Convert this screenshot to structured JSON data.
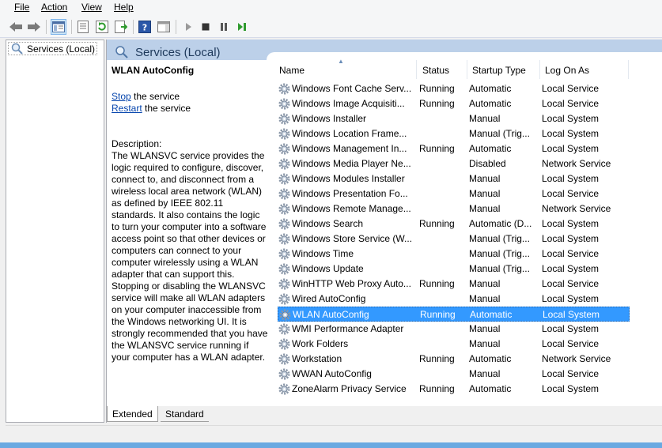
{
  "menu": [
    {
      "label": "File"
    },
    {
      "label": "Action"
    },
    {
      "label": "View"
    },
    {
      "label": "Help"
    }
  ],
  "tree": {
    "root_label": "Services (Local)"
  },
  "main": {
    "title": "Services (Local)",
    "selected_service": "WLAN AutoConfig",
    "stop_link": "Stop",
    "stop_suffix": " the service",
    "restart_link": "Restart",
    "restart_suffix": " the service",
    "description_label": "Description:",
    "description_text": "The WLANSVC service provides the logic required to configure, discover, connect to, and disconnect from a wireless local area network (WLAN) as defined by IEEE 802.11 standards. It also contains the logic to turn your computer into a software access point so that other devices or computers can connect to your computer wirelessly using a WLAN adapter that can support this. Stopping or disabling the WLANSVC service will make all WLAN adapters on your computer inaccessible from the Windows networking UI. It is strongly recommended that you have the WLANSVC service running if your computer has a WLAN adapter."
  },
  "columns": [
    "Name",
    "Status",
    "Startup Type",
    "Log On As"
  ],
  "services": [
    {
      "name": "Windows Font Cache Serv...",
      "status": "Running",
      "startup": "Automatic",
      "logon": "Local Service"
    },
    {
      "name": "Windows Image Acquisiti...",
      "status": "Running",
      "startup": "Automatic",
      "logon": "Local Service"
    },
    {
      "name": "Windows Installer",
      "status": "",
      "startup": "Manual",
      "logon": "Local System"
    },
    {
      "name": "Windows Location Frame...",
      "status": "",
      "startup": "Manual (Trig...",
      "logon": "Local System"
    },
    {
      "name": "Windows Management In...",
      "status": "Running",
      "startup": "Automatic",
      "logon": "Local System"
    },
    {
      "name": "Windows Media Player Ne...",
      "status": "",
      "startup": "Disabled",
      "logon": "Network Service"
    },
    {
      "name": "Windows Modules Installer",
      "status": "",
      "startup": "Manual",
      "logon": "Local System"
    },
    {
      "name": "Windows Presentation Fo...",
      "status": "",
      "startup": "Manual",
      "logon": "Local Service"
    },
    {
      "name": "Windows Remote Manage...",
      "status": "",
      "startup": "Manual",
      "logon": "Network Service"
    },
    {
      "name": "Windows Search",
      "status": "Running",
      "startup": "Automatic (D...",
      "logon": "Local System"
    },
    {
      "name": "Windows Store Service (W...",
      "status": "",
      "startup": "Manual (Trig...",
      "logon": "Local System"
    },
    {
      "name": "Windows Time",
      "status": "",
      "startup": "Manual (Trig...",
      "logon": "Local Service"
    },
    {
      "name": "Windows Update",
      "status": "",
      "startup": "Manual (Trig...",
      "logon": "Local System"
    },
    {
      "name": "WinHTTP Web Proxy Auto...",
      "status": "Running",
      "startup": "Manual",
      "logon": "Local Service"
    },
    {
      "name": "Wired AutoConfig",
      "status": "",
      "startup": "Manual",
      "logon": "Local System"
    },
    {
      "name": "WLAN AutoConfig",
      "status": "Running",
      "startup": "Automatic",
      "logon": "Local System"
    },
    {
      "name": "WMI Performance Adapter",
      "status": "",
      "startup": "Manual",
      "logon": "Local System"
    },
    {
      "name": "Work Folders",
      "status": "",
      "startup": "Manual",
      "logon": "Local Service"
    },
    {
      "name": "Workstation",
      "status": "Running",
      "startup": "Automatic",
      "logon": "Network Service"
    },
    {
      "name": "WWAN AutoConfig",
      "status": "",
      "startup": "Manual",
      "logon": "Local Service"
    },
    {
      "name": "ZoneAlarm Privacy Service",
      "status": "Running",
      "startup": "Automatic",
      "logon": "Local System"
    }
  ],
  "selected_index": 15,
  "tabs": [
    {
      "label": "Extended"
    },
    {
      "label": "Standard"
    }
  ],
  "colors": {
    "selection": "#3399ff",
    "header": "#bcd0e9",
    "link": "#0645ad"
  }
}
